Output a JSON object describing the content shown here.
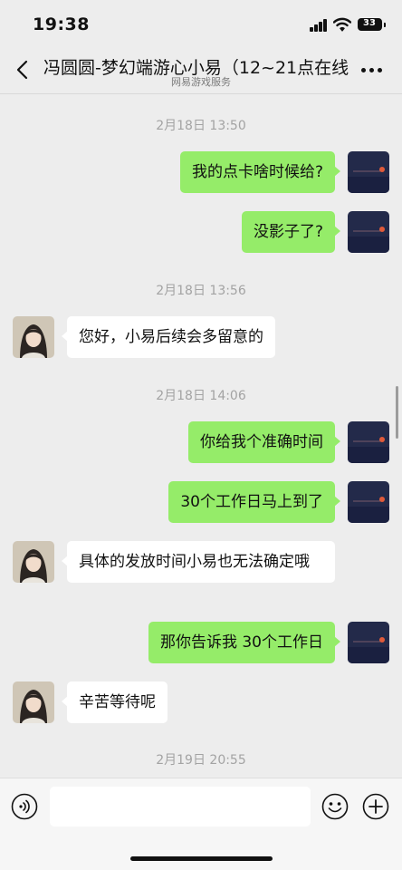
{
  "status_bar": {
    "time": "19:38",
    "battery": "33"
  },
  "header": {
    "title": "冯圆圆-梦幻端游心小易（12~21点在线",
    "subtitle": "网易游戏服务"
  },
  "messages": [
    {
      "type": "timestamp",
      "text": "2月18日 13:50"
    },
    {
      "type": "message",
      "side": "right",
      "text": "我的点卡啥时候给?"
    },
    {
      "type": "message",
      "side": "right",
      "text": "没影子了?"
    },
    {
      "type": "timestamp",
      "text": "2月18日 13:56"
    },
    {
      "type": "message",
      "side": "left",
      "text": "您好，小易后续会多留意的"
    },
    {
      "type": "timestamp",
      "text": "2月18日 14:06"
    },
    {
      "type": "message",
      "side": "right",
      "text": "你给我个准确时间"
    },
    {
      "type": "message",
      "side": "right",
      "text": "30个工作日马上到了"
    },
    {
      "type": "message",
      "side": "left",
      "text": "具体的发放时间小易也无法确定哦"
    },
    {
      "type": "message",
      "side": "right",
      "text": "那你告诉我 30个工作日"
    },
    {
      "type": "message",
      "side": "left",
      "text": "辛苦等待呢"
    },
    {
      "type": "timestamp",
      "text": "2月19日 20:55"
    }
  ],
  "input": {
    "value": "",
    "placeholder": ""
  },
  "colors": {
    "background": "#ededed",
    "sent_bubble": "#95ec69",
    "received_bubble": "#ffffff",
    "timestamp_text": "#a3a3a3"
  },
  "icons": {
    "back": "chevron-left-icon",
    "more": "more-icon",
    "voice": "voice-icon",
    "emoji": "emoji-icon",
    "plus": "plus-icon"
  }
}
